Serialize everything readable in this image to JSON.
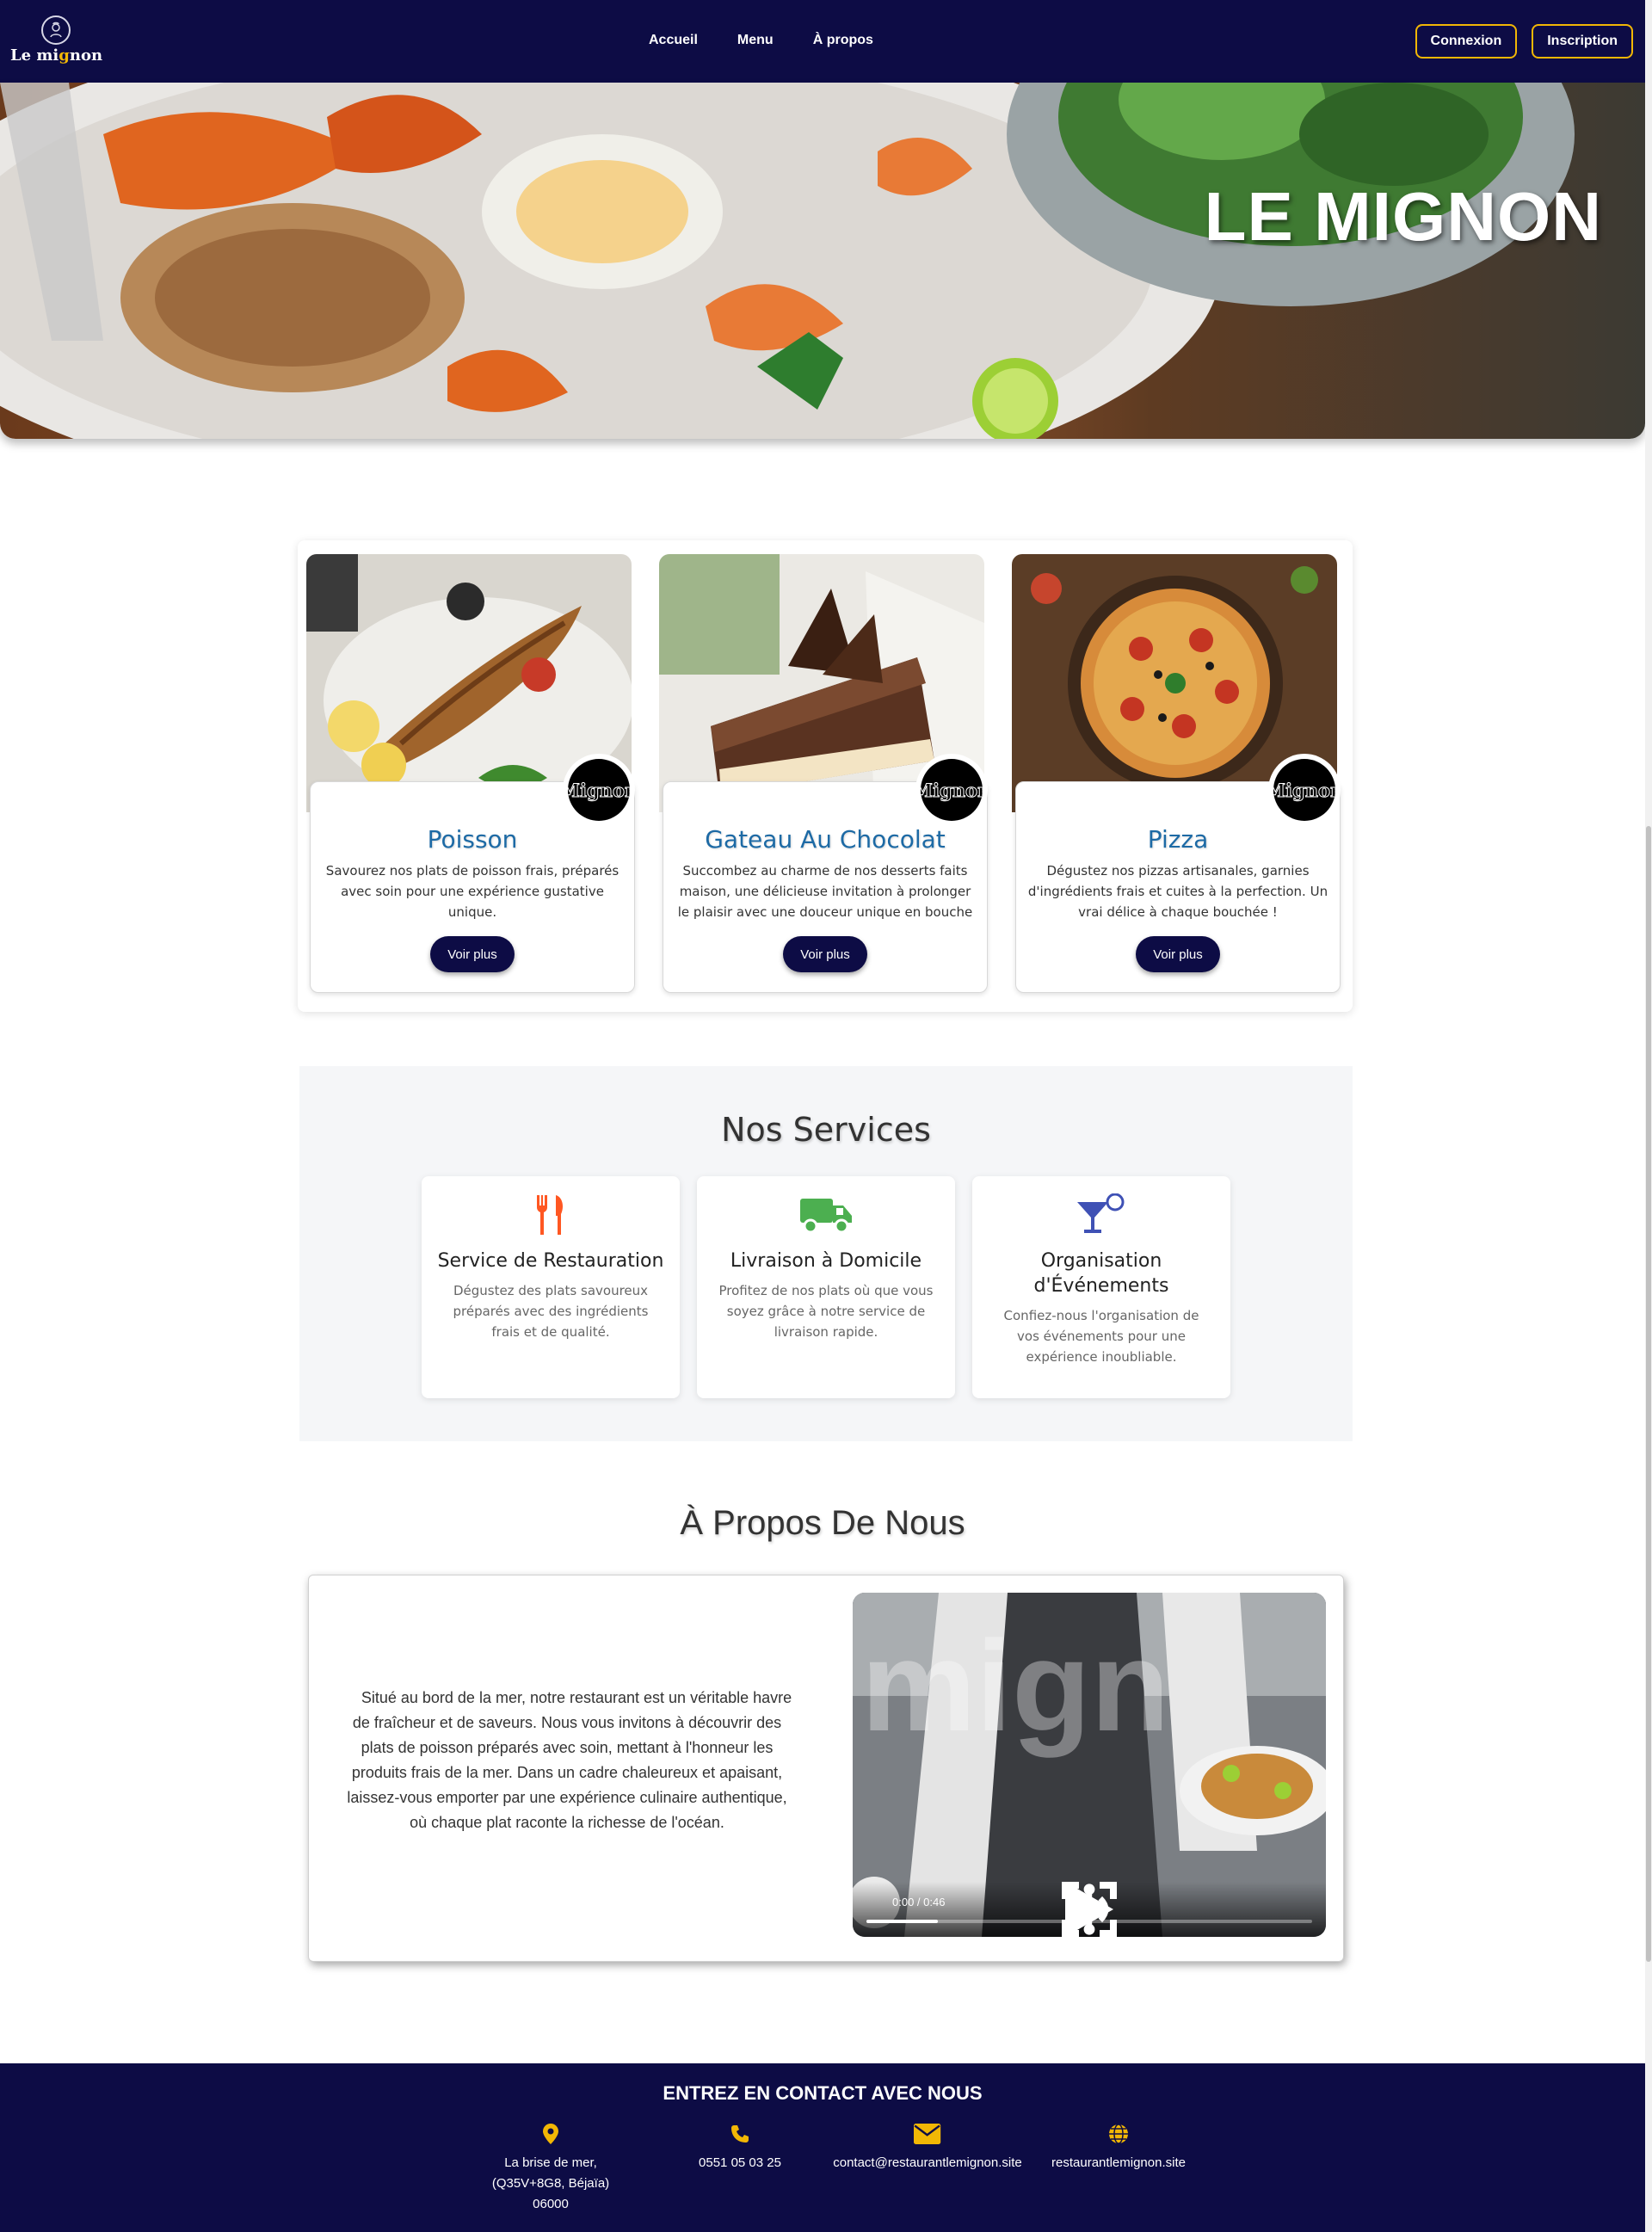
{
  "nav": {
    "brand_prefix": "Le mi",
    "brand_accent": "g",
    "brand_suffix": "non",
    "links": [
      "Accueil",
      "Menu",
      "À propos"
    ],
    "login": "Connexion",
    "signup": "Inscription"
  },
  "hero": {
    "title": "LE MIGNON"
  },
  "cards": [
    {
      "title": "Poisson",
      "desc": "Savourez nos plats de poisson frais, préparés avec soin pour une expérience gustative unique.",
      "button": "Voir plus",
      "badge": "Mignon",
      "image_icon": "fish-dish-image"
    },
    {
      "title": "Gateau Au Chocolat",
      "desc": "Succombez au charme de nos desserts faits maison, une délicieuse invitation à prolonger le plaisir avec une douceur unique en bouche",
      "button": "Voir plus",
      "badge": "Mignon",
      "image_icon": "chocolate-cake-image"
    },
    {
      "title": "Pizza",
      "desc": "Dégustez nos pizzas artisanales, garnies d'ingrédients frais et cuites à la perfection. Un vrai délice à chaque bouchée !",
      "button": "Voir plus",
      "badge": "Mignon",
      "image_icon": "pizza-image"
    }
  ],
  "services": {
    "title": "Nos Services",
    "items": [
      {
        "title": "Service de Restauration",
        "desc": "Dégustez des plats savoureux préparés avec des ingrédients frais et de qualité.",
        "icon": "utensils-icon",
        "color": "#ff5722"
      },
      {
        "title": "Livraison à Domicile",
        "desc": "Profitez de nos plats où que vous soyez grâce à notre service de livraison rapide.",
        "icon": "truck-icon",
        "color": "#4caf50"
      },
      {
        "title": "Organisation d'Événements",
        "desc": "Confiez-nous l'organisation de vos événements pour une expérience inoubliable.",
        "icon": "cocktail-icon",
        "color": "#3f51b5"
      }
    ]
  },
  "about": {
    "title": "À Propos De Nous",
    "text": "Situé au bord de la mer, notre restaurant est un véritable havre de fraîcheur et de saveurs. Nous vous invitons à découvrir des plats de poisson préparés avec soin, mettant à l'honneur les produits frais de la mer. Dans un cadre chaleureux et apaisant, laissez-vous emporter par une expérience culinaire authentique, où chaque plat raconte la richesse de l'océan.",
    "video": {
      "time": "0:00 / 0:46",
      "progress": 0.16
    }
  },
  "footer": {
    "title": "ENTREZ EN CONTACT AVEC NOUS",
    "address": [
      "La brise de mer,",
      "(Q35V+8G8, Béjaïa)",
      "06000"
    ],
    "phone": "0551 05 03 25",
    "email": "contact@restaurantlemignon.site",
    "website": "restaurantlemignon.site"
  },
  "colors": {
    "navy": "#0d0c45",
    "gold": "#f2b705",
    "card_title": "#1d6aa5"
  }
}
